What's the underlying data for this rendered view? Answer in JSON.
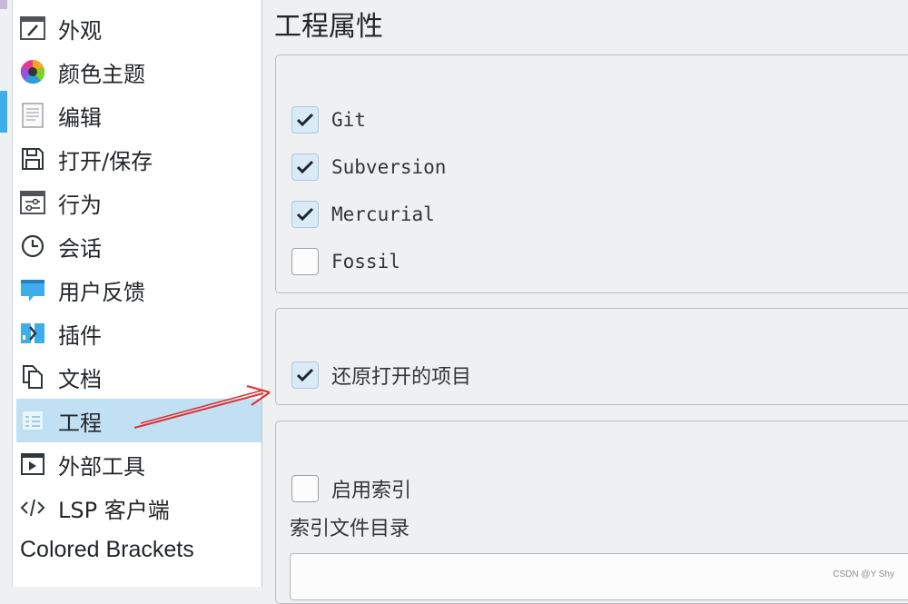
{
  "sidebar": {
    "items": [
      {
        "label": "外观",
        "icon": "appearance-icon"
      },
      {
        "label": "颜色主题",
        "icon": "color-theme-icon"
      },
      {
        "label": "编辑",
        "icon": "editing-icon"
      },
      {
        "label": "打开/保存",
        "icon": "save-icon"
      },
      {
        "label": "行为",
        "icon": "behavior-icon"
      },
      {
        "label": "会话",
        "icon": "session-clock-icon"
      },
      {
        "label": "用户反馈",
        "icon": "feedback-icon"
      },
      {
        "label": "插件",
        "icon": "plugins-icon"
      },
      {
        "label": "文档",
        "icon": "documents-icon"
      },
      {
        "label": "工程",
        "icon": "project-icon",
        "selected": true
      },
      {
        "label": "外部工具",
        "icon": "external-tools-icon"
      },
      {
        "label": "LSP 客户端",
        "icon": "code-brackets-icon"
      },
      {
        "label": "Colored Brackets",
        "icon": ""
      }
    ]
  },
  "main": {
    "title": "工程属性",
    "vcs_group": {
      "options": [
        {
          "label": "Git",
          "checked": true
        },
        {
          "label": "Subversion",
          "checked": true
        },
        {
          "label": "Mercurial",
          "checked": true
        },
        {
          "label": "Fossil",
          "checked": false
        }
      ]
    },
    "restore_group": {
      "option": {
        "label": "还原打开的项目",
        "checked": true
      }
    },
    "index_group": {
      "enable_label": "启用索引",
      "enable_checked": false,
      "dir_label": "索引文件目录",
      "dir_value": ""
    }
  },
  "watermark": "CSDN @Y Shy",
  "colors": {
    "selection": "#c2e0f4",
    "accent": "#3daee9",
    "annotation_arrow": "#e03030"
  }
}
